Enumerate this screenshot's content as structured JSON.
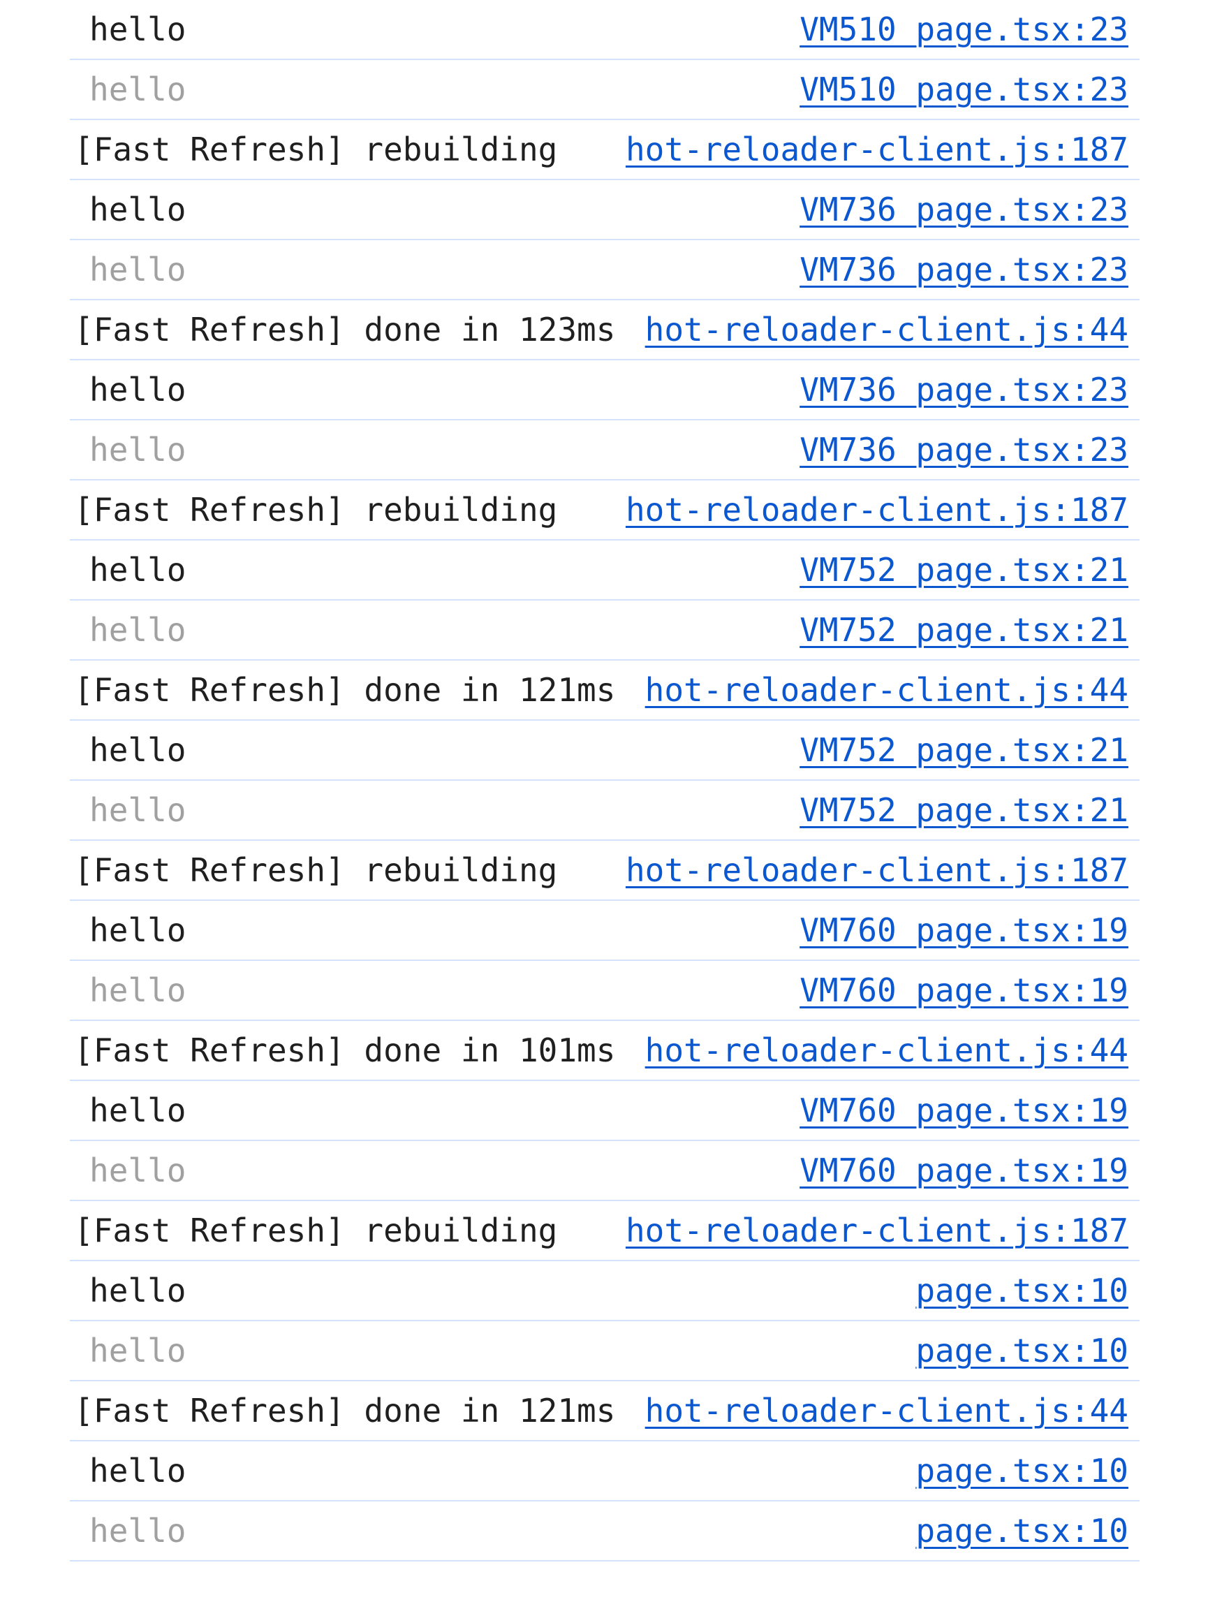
{
  "console": {
    "messages": [
      {
        "text": "hello",
        "source": "VM510 page.tsx:23",
        "kind": "log",
        "dim": false
      },
      {
        "text": "hello",
        "source": "VM510 page.tsx:23",
        "kind": "log",
        "dim": true
      },
      {
        "text": "[Fast Refresh] rebuilding",
        "source": "hot-reloader-client.js:187",
        "kind": "info",
        "dim": false
      },
      {
        "text": "hello",
        "source": "VM736 page.tsx:23",
        "kind": "log",
        "dim": false
      },
      {
        "text": "hello",
        "source": "VM736 page.tsx:23",
        "kind": "log",
        "dim": true
      },
      {
        "text": "[Fast Refresh] done in 123ms",
        "source": "hot-reloader-client.js:44",
        "kind": "info",
        "dim": false
      },
      {
        "text": "hello",
        "source": "VM736 page.tsx:23",
        "kind": "log",
        "dim": false
      },
      {
        "text": "hello",
        "source": "VM736 page.tsx:23",
        "kind": "log",
        "dim": true
      },
      {
        "text": "[Fast Refresh] rebuilding",
        "source": "hot-reloader-client.js:187",
        "kind": "info",
        "dim": false
      },
      {
        "text": "hello",
        "source": "VM752 page.tsx:21",
        "kind": "log",
        "dim": false
      },
      {
        "text": "hello",
        "source": "VM752 page.tsx:21",
        "kind": "log",
        "dim": true
      },
      {
        "text": "[Fast Refresh] done in 121ms",
        "source": "hot-reloader-client.js:44",
        "kind": "info",
        "dim": false
      },
      {
        "text": "hello",
        "source": "VM752 page.tsx:21",
        "kind": "log",
        "dim": false
      },
      {
        "text": "hello",
        "source": "VM752 page.tsx:21",
        "kind": "log",
        "dim": true
      },
      {
        "text": "[Fast Refresh] rebuilding",
        "source": "hot-reloader-client.js:187",
        "kind": "info",
        "dim": false
      },
      {
        "text": "hello",
        "source": "VM760 page.tsx:19",
        "kind": "log",
        "dim": false
      },
      {
        "text": "hello",
        "source": "VM760 page.tsx:19",
        "kind": "log",
        "dim": true
      },
      {
        "text": "[Fast Refresh] done in 101ms",
        "source": "hot-reloader-client.js:44",
        "kind": "info",
        "dim": false
      },
      {
        "text": "hello",
        "source": "VM760 page.tsx:19",
        "kind": "log",
        "dim": false
      },
      {
        "text": "hello",
        "source": "VM760 page.tsx:19",
        "kind": "log",
        "dim": true
      },
      {
        "text": "[Fast Refresh] rebuilding",
        "source": "hot-reloader-client.js:187",
        "kind": "info",
        "dim": false
      },
      {
        "text": "hello",
        "source": "page.tsx:10",
        "kind": "log",
        "dim": false
      },
      {
        "text": "hello",
        "source": "page.tsx:10",
        "kind": "log",
        "dim": true
      },
      {
        "text": "[Fast Refresh] done in 121ms",
        "source": "hot-reloader-client.js:44",
        "kind": "info",
        "dim": false
      },
      {
        "text": "hello",
        "source": "page.tsx:10",
        "kind": "log",
        "dim": false
      },
      {
        "text": "hello",
        "source": "page.tsx:10",
        "kind": "log",
        "dim": true
      }
    ]
  },
  "colors": {
    "text": "#1f1f1f",
    "dim_text": "#a0a0a0",
    "link": "#0b57d0",
    "row_divider": "#d3e3fd"
  }
}
